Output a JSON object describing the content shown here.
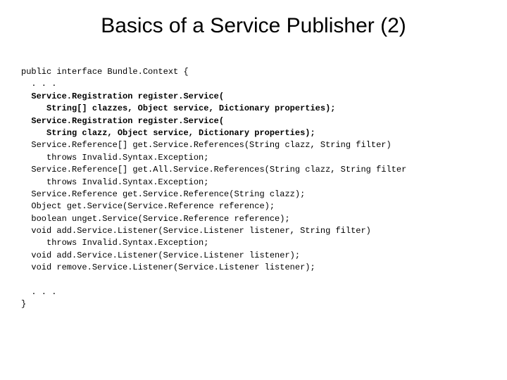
{
  "title": "Basics of a Service Publisher (2)",
  "code": {
    "l01": "public interface Bundle.Context {",
    "l02": "  . . .",
    "l03": "  Service.Registration register.Service(",
    "l04": "     String[] clazzes, Object service, Dictionary properties);",
    "l05": "  Service.Registration register.Service(",
    "l06": "     String clazz, Object service, Dictionary properties);",
    "l07": "  Service.Reference[] get.Service.References(String clazz, String filter)",
    "l08": "     throws Invalid.Syntax.Exception;",
    "l09": "  Service.Reference[] get.All.Service.References(String clazz, String filter",
    "l10": "     throws Invalid.Syntax.Exception;",
    "l11": "  Service.Reference get.Service.Reference(String clazz);",
    "l12": "  Object get.Service(Service.Reference reference);",
    "l13": "  boolean unget.Service(Service.Reference reference);",
    "l14": "  void add.Service.Listener(Service.Listener listener, String filter)",
    "l15": "     throws Invalid.Syntax.Exception;",
    "l16": "  void add.Service.Listener(Service.Listener listener);",
    "l17": "  void remove.Service.Listener(Service.Listener listener);",
    "l18": "",
    "l19": "  . . .",
    "l20": "}"
  }
}
